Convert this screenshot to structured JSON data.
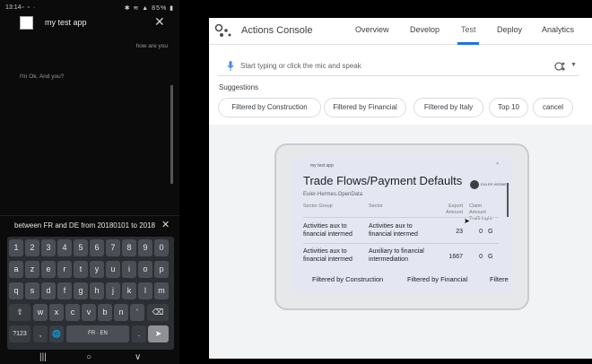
{
  "phone": {
    "status": {
      "time": "13:14",
      "icons": "▫ ▫ ·",
      "right": "✱ ≋ ▲ 85% ▮"
    },
    "app_title": "my test app",
    "messages": [
      {
        "from": "user",
        "text": "how are you"
      },
      {
        "from": "assistant",
        "text": "I'm Ok. And you?"
      }
    ],
    "query_text": "between FR and DE from 20180101 to 2018",
    "keyboard": {
      "row1": [
        "1",
        "2",
        "3",
        "4",
        "5",
        "6",
        "7",
        "8",
        "9",
        "0"
      ],
      "row2": [
        "a",
        "z",
        "e",
        "r",
        "t",
        "y",
        "u",
        "i",
        "o",
        "p"
      ],
      "row3": [
        "q",
        "s",
        "d",
        "f",
        "g",
        "h",
        "j",
        "k",
        "l",
        "m"
      ],
      "row4": [
        "⇧",
        "w",
        "x",
        "c",
        "v",
        "b",
        "n",
        "'",
        "⌫"
      ],
      "row5": [
        "?123",
        ",",
        "🌐",
        "FR · EN",
        ".",
        "➤"
      ]
    },
    "navbar": [
      "|||",
      "○",
      "∨"
    ]
  },
  "console": {
    "brand": "Actions Console",
    "tabs": [
      "Overview",
      "Develop",
      "Test",
      "Deploy",
      "Analytics"
    ],
    "active_tab": "Test",
    "input_placeholder": "Start typing or click the mic and speak",
    "suggestions_title": "Suggestions",
    "suggestions": [
      "Filtered by Construction",
      "Filtered by Financial",
      "Filtered by Italy",
      "Top 10",
      "cancel"
    ],
    "device": {
      "app_name": "my test app",
      "close": "×",
      "card_title": "Trade Flows/Payment Defaults",
      "card_subtitle": "Euler-Hermes.OpenData",
      "logo_text": "EULER HERMES",
      "headers": [
        "Sector Group",
        "Sector",
        "Export Amount",
        "Claim Amount",
        "Traffi Light"
      ],
      "rows": [
        {
          "group": "Activities aux to financial intermed",
          "sector": "Activities aux to financial intermed",
          "export": "23",
          "claim": "0",
          "light": "G"
        },
        {
          "group": "Activities aux to financial intermed",
          "sector": "Auxiliary to financial intermediation",
          "export": "1667",
          "claim": "0",
          "light": "G"
        }
      ],
      "chips": [
        "Filtered by Construction",
        "Filtered by Financial",
        "Filtere"
      ]
    }
  }
}
